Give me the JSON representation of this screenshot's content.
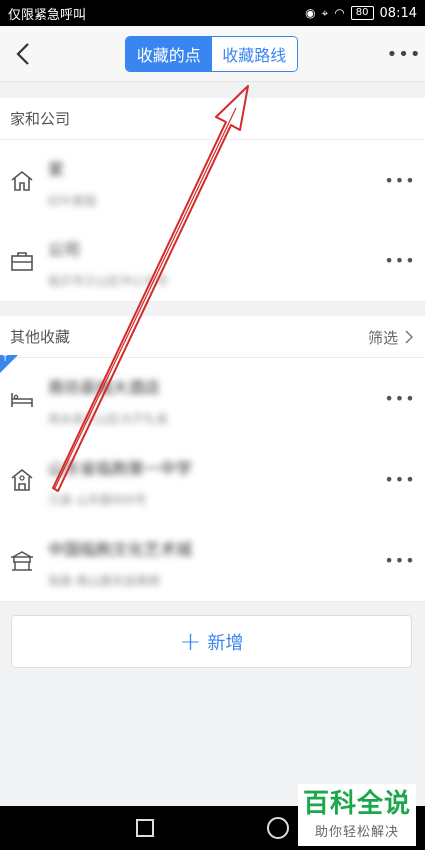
{
  "status_bar": {
    "carrier": "仅限紧急呼叫",
    "battery": "80",
    "time": "08:14",
    "icons": [
      "signal-icon",
      "location-icon",
      "wifi-icon",
      "battery-icon"
    ]
  },
  "header": {
    "tabs": [
      {
        "label": "收藏的点",
        "active": true
      },
      {
        "label": "收藏路线",
        "active": false
      }
    ],
    "more_label": "•••"
  },
  "sections": {
    "home_company": {
      "title": "家和公司",
      "items": [
        {
          "icon": "home-icon",
          "title": "家",
          "subtitle": "红叶家园"
        },
        {
          "icon": "briefcase-icon",
          "title": "公司",
          "subtitle": "临沂市兰山区中心中号"
        }
      ]
    },
    "others": {
      "title": "其他收藏",
      "filter_label": "筛选",
      "items": [
        {
          "icon": "bed-icon",
          "title": "南坊县城大酒店",
          "subtitle": "商水县兰山区大厅礼县"
        },
        {
          "icon": "school-icon",
          "title": "山东省临朐第一中学",
          "subtitle": "兰县 山东路900号"
        },
        {
          "icon": "building-icon",
          "title": "中国临朐文化艺术城",
          "subtitle": "张路 南山路东延南侧"
        }
      ]
    }
  },
  "add_button": {
    "plus": "+",
    "label": "新增"
  },
  "row_more_label": "•••",
  "pin_badge": "↑",
  "watermark": {
    "title": "百科全说",
    "subtitle": "助你轻松解决"
  },
  "colors": {
    "accent": "#3a86f0",
    "annotation": "#d42a2a",
    "watermark": "#1ba84a"
  }
}
